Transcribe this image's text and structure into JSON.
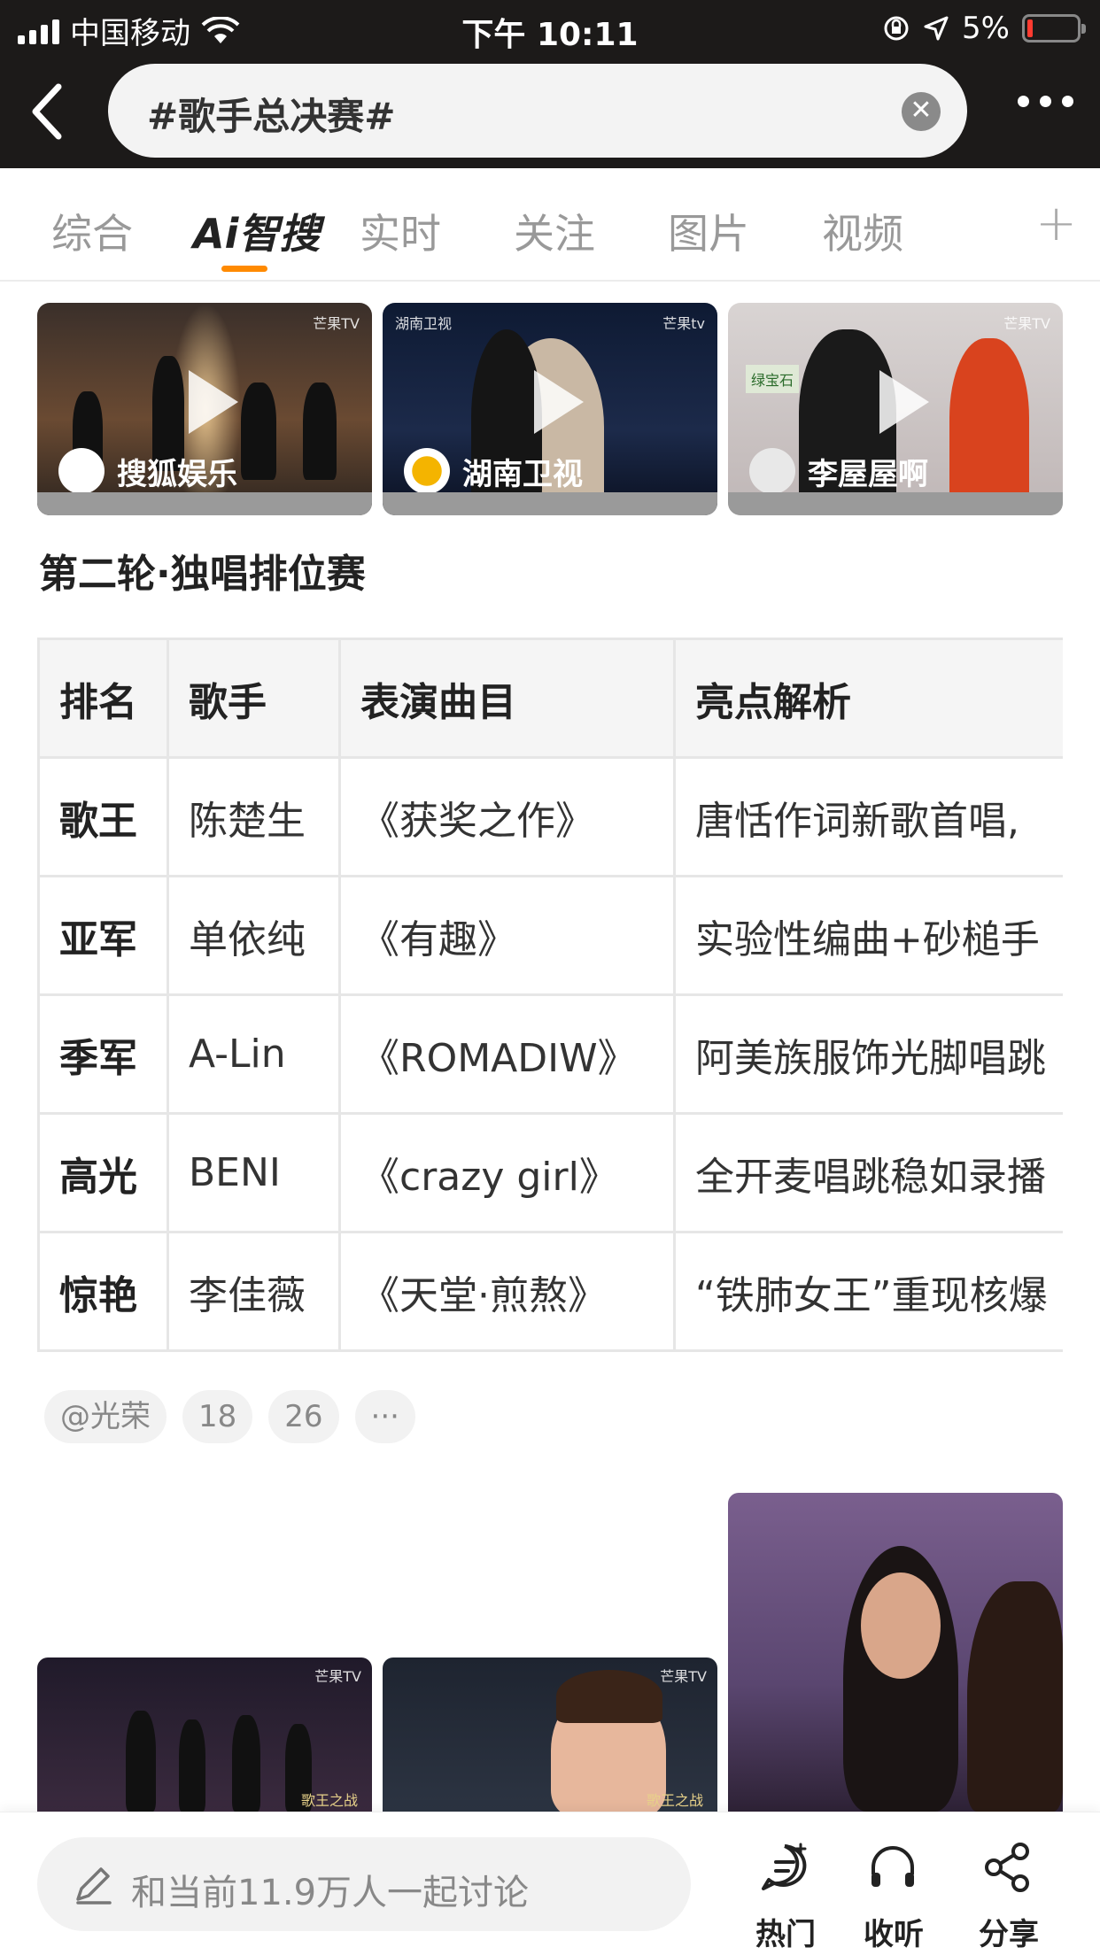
{
  "status": {
    "carrier": "中国移动",
    "time": "下午 10:11",
    "battery": "5%"
  },
  "search": {
    "query": "#歌手总决赛#"
  },
  "tabs": [
    {
      "label": "综合"
    },
    {
      "label": "Ai智搜"
    },
    {
      "label": "实时"
    },
    {
      "label": "关注"
    },
    {
      "label": "图片"
    },
    {
      "label": "视频"
    },
    {
      "label": "+"
    }
  ],
  "videos": [
    {
      "source": "搜狐娱乐",
      "watermark": "芒果TV",
      "corner": "搜狐娱乐"
    },
    {
      "source": "湖南卫视",
      "watermark": "芒果tv",
      "corner": "湖南卫视"
    },
    {
      "source": "李屋屋啊",
      "watermark": "芒果TV",
      "corner": "绿宝石"
    }
  ],
  "section_title": "第二轮·独唱排位赛",
  "table": {
    "headers": [
      "排名",
      "歌手",
      "表演曲目",
      "亮点解析"
    ],
    "rows": [
      [
        "歌王",
        "陈楚生",
        "《获奖之作》",
        "唐恬作词新歌首唱,"
      ],
      [
        "亚军",
        "单依纯",
        "《有趣》",
        "实验性编曲+砂槌手"
      ],
      [
        "季军",
        "A-Lin",
        "《ROMADIW》",
        "阿美族服饰光脚唱跳"
      ],
      [
        "高光",
        "BENI",
        "《crazy girl》",
        "全开麦唱跳稳如录播"
      ],
      [
        "惊艳",
        "李佳薇",
        "《天堂·煎熬》",
        "“铁肺女王”重现核爆"
      ]
    ]
  },
  "chips": [
    "@光荣",
    "18",
    "26",
    "···"
  ],
  "gallery": [
    {
      "watermark": "芒果TV",
      "caption": "歌王之战"
    },
    {
      "watermark": "芒果TV",
      "caption": "歌王之战"
    }
  ],
  "bottom": {
    "placeholder": "和当前11.9万人一起讨论",
    "actions": [
      "热门",
      "收听",
      "分享"
    ]
  }
}
